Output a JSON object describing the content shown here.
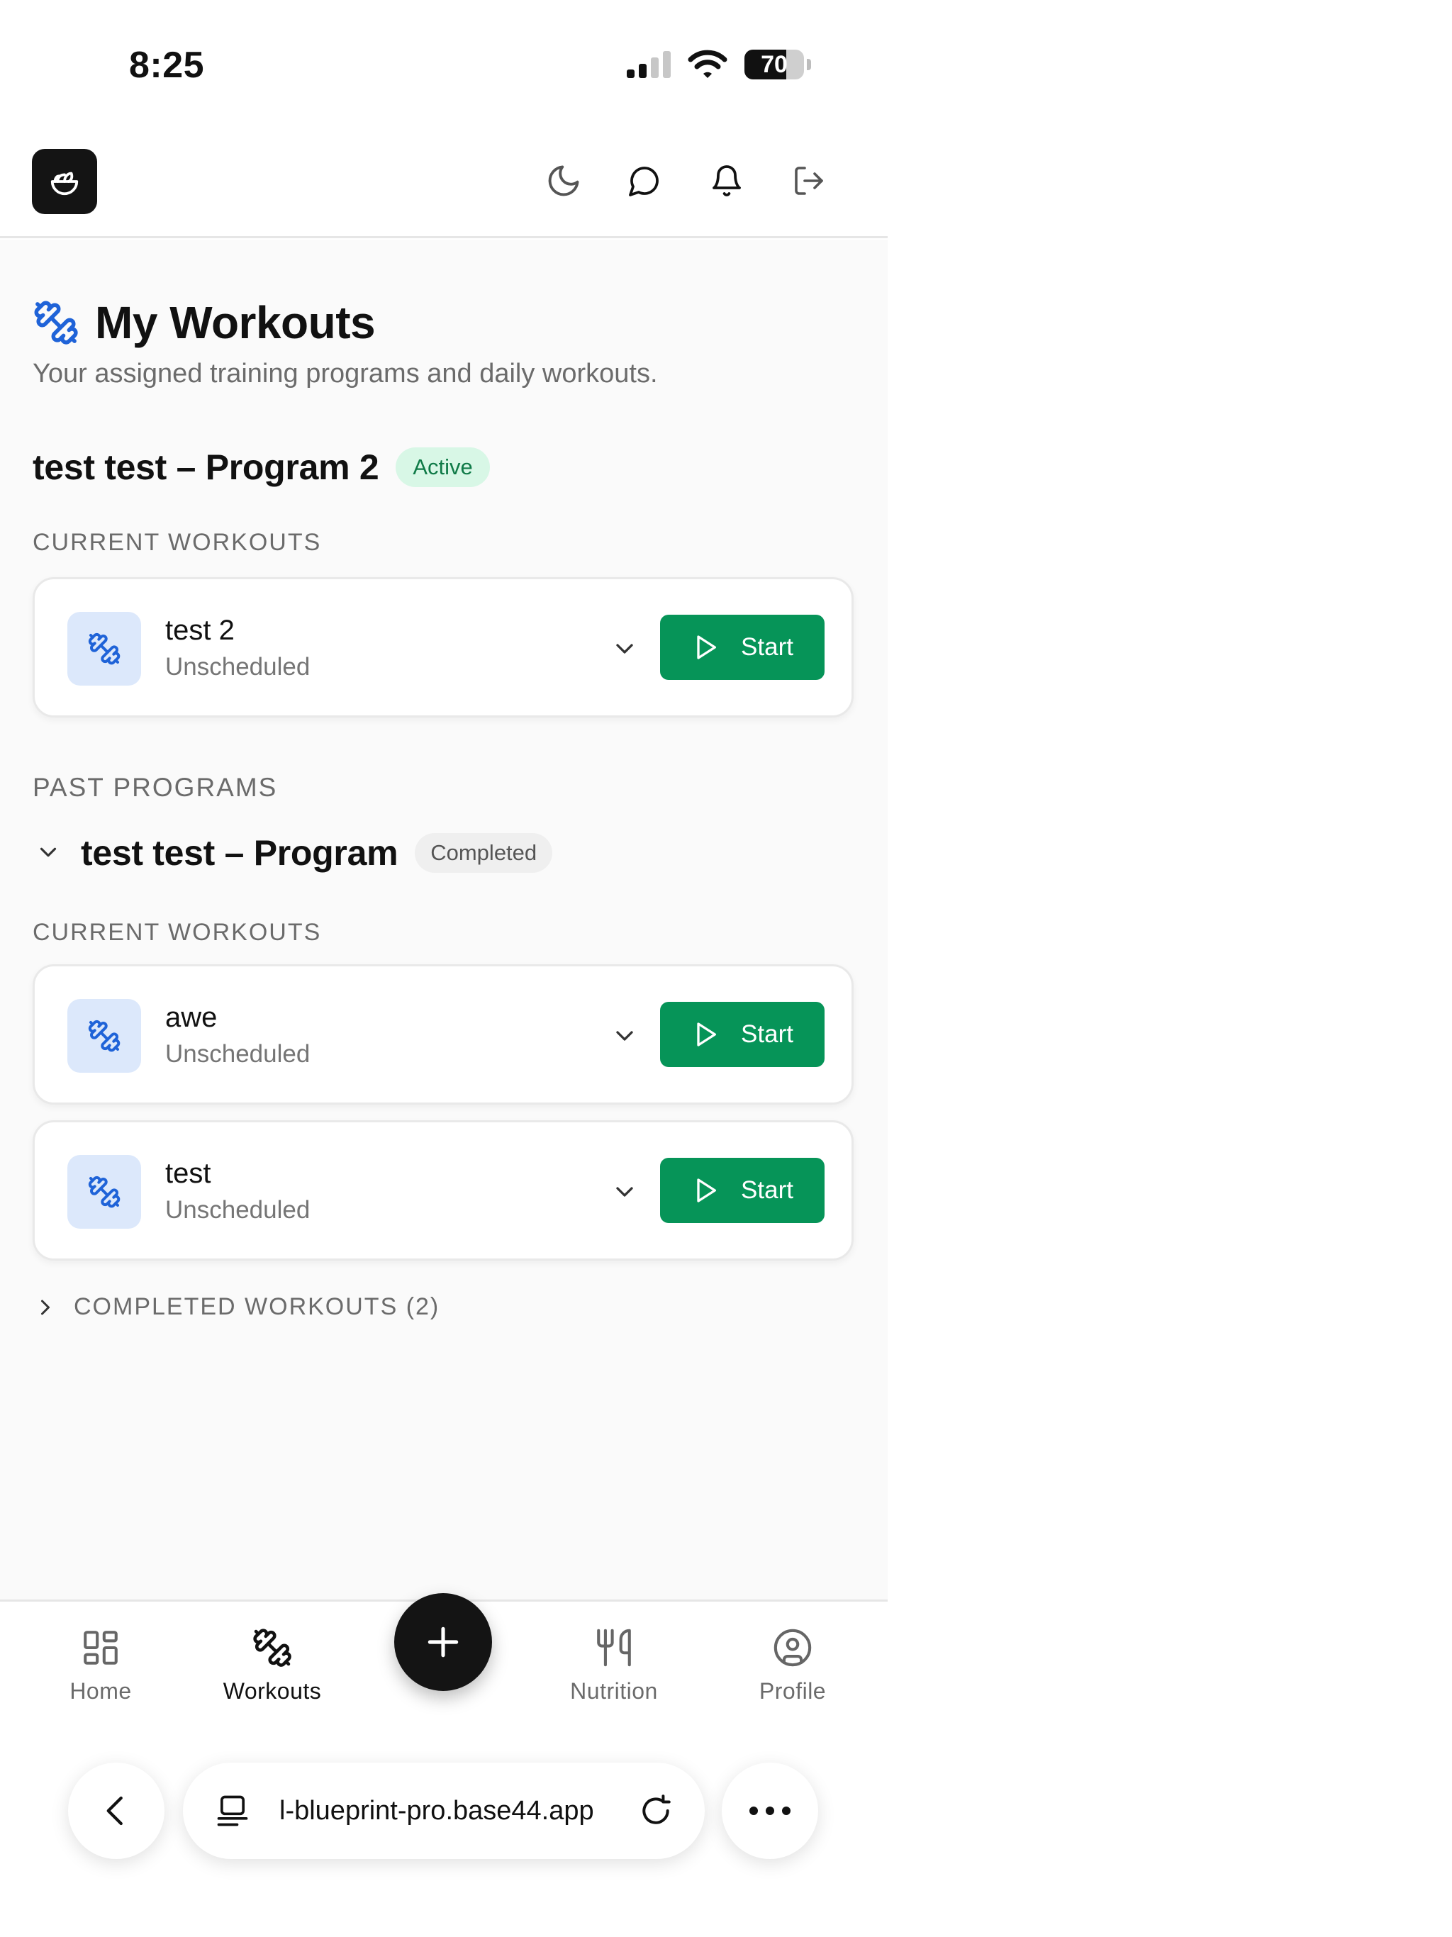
{
  "status_bar": {
    "time": "8:25",
    "battery_level": "70"
  },
  "header": {
    "icons": [
      "moon-icon",
      "chat-icon",
      "bell-icon",
      "logout-icon"
    ]
  },
  "page": {
    "title": "My Workouts",
    "subtitle": "Your assigned training programs and daily workouts."
  },
  "active_program": {
    "name": "test test – Program 2",
    "status": "Active",
    "section_label": "CURRENT WORKOUTS",
    "workouts": [
      {
        "name": "test 2",
        "schedule": "Unscheduled",
        "action": "Start"
      }
    ]
  },
  "past_programs": {
    "section_label": "PAST PROGRAMS",
    "programs": [
      {
        "name": "test test – Program",
        "status": "Completed",
        "section_label": "CURRENT WORKOUTS",
        "workouts": [
          {
            "name": "awe",
            "schedule": "Unscheduled",
            "action": "Start"
          },
          {
            "name": "test",
            "schedule": "Unscheduled",
            "action": "Start"
          }
        ],
        "completed_toggle": "COMPLETED WORKOUTS (2)"
      }
    ]
  },
  "bottom_nav": {
    "items": [
      {
        "label": "Home",
        "icon": "grid-icon"
      },
      {
        "label": "Workouts",
        "icon": "dumbbell-icon",
        "active": true
      },
      {
        "label": "Nutrition",
        "icon": "fork-knife-icon"
      },
      {
        "label": "Profile",
        "icon": "user-circle-icon"
      }
    ]
  },
  "browser": {
    "url": "l-blueprint-pro.base44.app"
  },
  "colors": {
    "accent_green": "#069458",
    "active_badge_bg": "#d8f7e6",
    "icon_blue": "#1f63d8",
    "dark": "#141414"
  }
}
